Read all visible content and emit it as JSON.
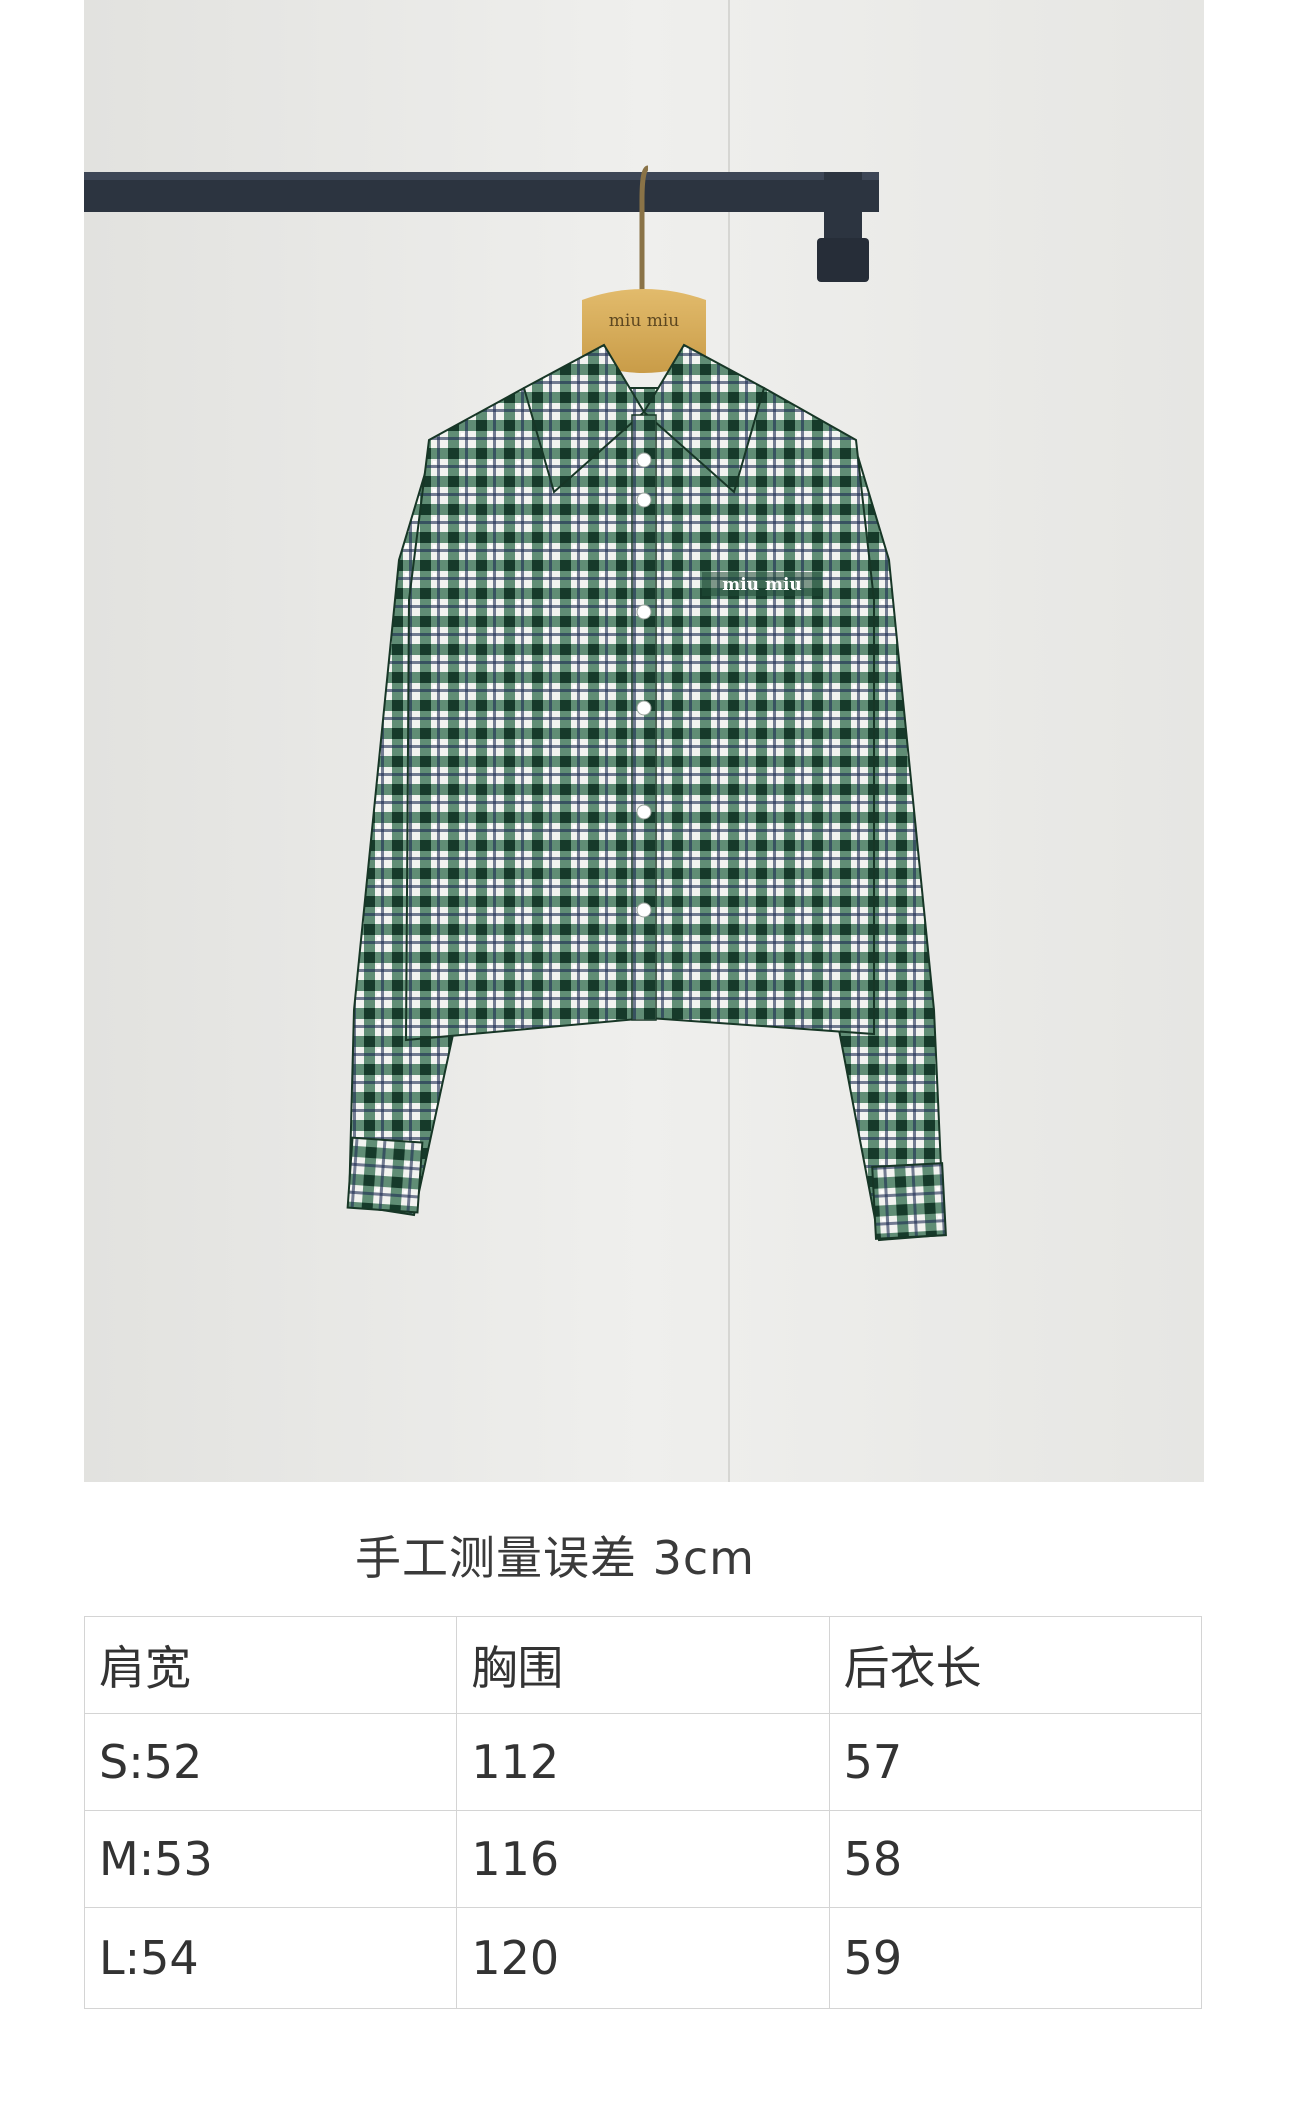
{
  "photo": {
    "hanger_brand": "miu miu",
    "chest_logo": "miu miu",
    "colors": {
      "wall": "#ebebe9",
      "rack": "#2c3440",
      "hanger": "#d2a756",
      "plaid_base": "#1f4a35",
      "plaid_light": "#f2f3f0"
    }
  },
  "caption": "手工测量误差 3cm",
  "size_table": {
    "headers": [
      "肩宽",
      "胸围",
      "后衣长"
    ],
    "rows": [
      [
        "S:52",
        "112",
        "57"
      ],
      [
        "M:53",
        "116",
        "58"
      ],
      [
        "L:54",
        "120",
        "59"
      ]
    ]
  }
}
